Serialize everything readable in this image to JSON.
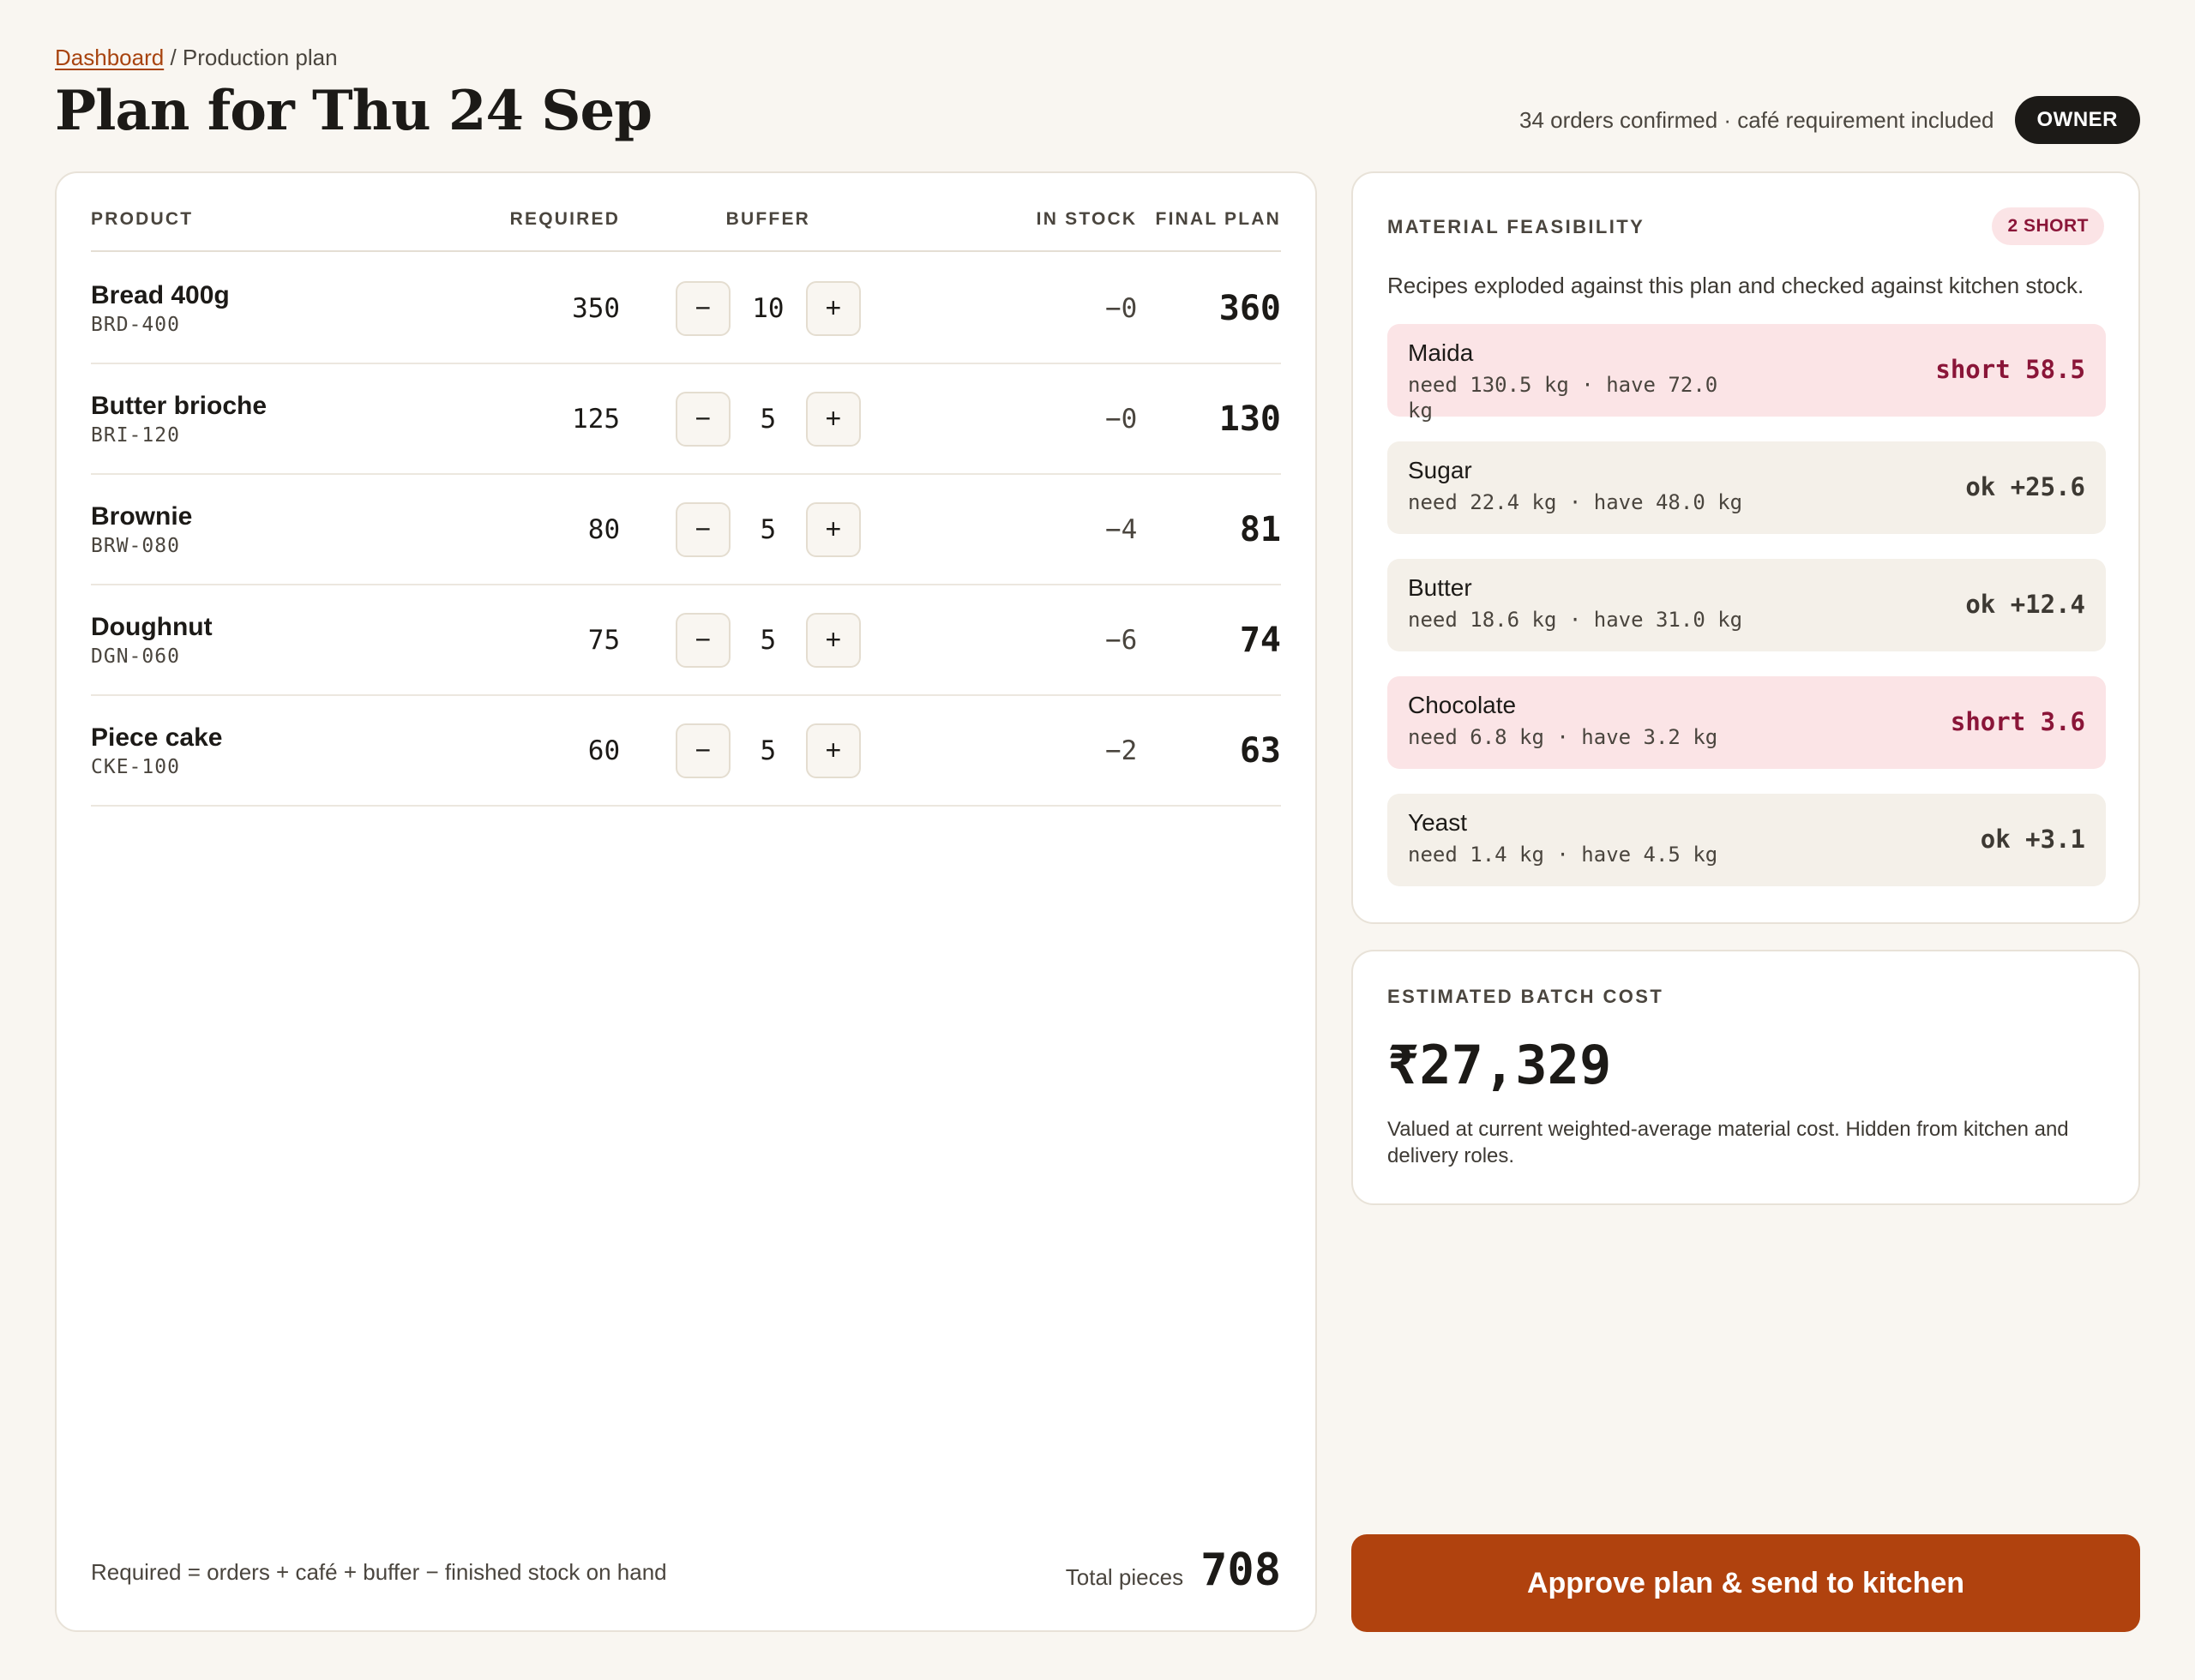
{
  "breadcrumb": {
    "parent": "Dashboard",
    "separator": "/",
    "current": "Production plan"
  },
  "page_title": "Plan for Thu 24 Sep",
  "meta": {
    "summary": "34 orders confirmed · café requirement included",
    "role": "OWNER"
  },
  "plan_table": {
    "headers": {
      "product": "PRODUCT",
      "required": "REQUIRED",
      "buffer": "BUFFER",
      "in_stock": "IN STOCK",
      "final_plan": "FINAL PLAN"
    },
    "decrement_symbol": "−",
    "increment_symbol": "+",
    "rows": [
      {
        "name": "Bread 400g",
        "sku": "BRD-400",
        "required": "350",
        "buffer": "10",
        "in_stock": "−0",
        "final": "360"
      },
      {
        "name": "Butter brioche",
        "sku": "BRI-120",
        "required": "125",
        "buffer": "5",
        "in_stock": "−0",
        "final": "130"
      },
      {
        "name": "Brownie",
        "sku": "BRW-080",
        "required": "80",
        "buffer": "5",
        "in_stock": "−4",
        "final": "81"
      },
      {
        "name": "Doughnut",
        "sku": "DGN-060",
        "required": "75",
        "buffer": "5",
        "in_stock": "−6",
        "final": "74"
      },
      {
        "name": "Piece cake",
        "sku": "CKE-100",
        "required": "60",
        "buffer": "5",
        "in_stock": "−2",
        "final": "63"
      }
    ],
    "footnote": "Required = orders + café + buffer − finished stock on hand",
    "total_label": "Total pieces",
    "total_value": "708"
  },
  "feasibility": {
    "title": "MATERIAL FEASIBILITY",
    "badge": "2 SHORT",
    "description": "Recipes exploded against this plan and checked against kitchen stock.",
    "materials": [
      {
        "name": "Maida",
        "detail": "need 130.5 kg · have 72.0 kg",
        "status": "short 58.5",
        "short": true
      },
      {
        "name": "Sugar",
        "detail": "need 22.4 kg · have 48.0 kg",
        "status": "ok +25.6",
        "short": false
      },
      {
        "name": "Butter",
        "detail": "need 18.6 kg · have 31.0 kg",
        "status": "ok +12.4",
        "short": false
      },
      {
        "name": "Chocolate",
        "detail": "need 6.8 kg · have 3.2 kg",
        "status": "short 3.6",
        "short": true
      },
      {
        "name": "Yeast",
        "detail": "need 1.4 kg · have 4.5 kg",
        "status": "ok +3.1",
        "short": false
      }
    ],
    "colors": {
      "short_bg": "#fbe4e6",
      "short_text": "#8a1538",
      "ok_bg": "#f4f0e9"
    }
  },
  "cost": {
    "title": "ESTIMATED BATCH COST",
    "value": "₹27,329",
    "note": "Valued at current weighted-average material cost. Hidden from kitchen and delivery roles."
  },
  "approve_button": "Approve plan & send to kitchen",
  "colors": {
    "accent": "#b0420e",
    "background": "#f9f6f1",
    "link": "#a8440f"
  }
}
